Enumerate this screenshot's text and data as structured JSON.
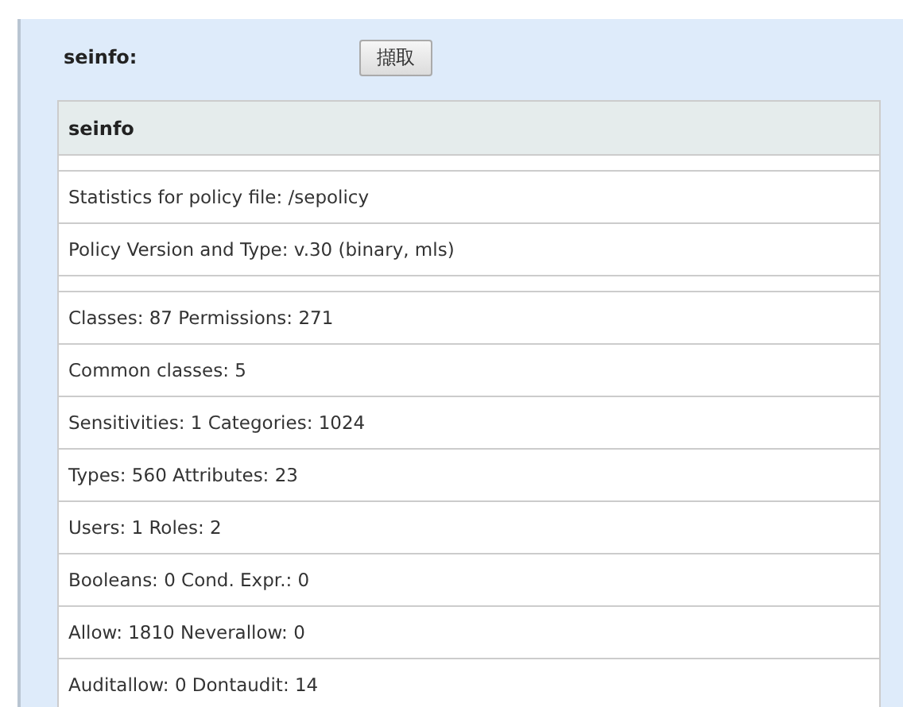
{
  "form": {
    "label": "seinfo:",
    "button": "擷取"
  },
  "table": {
    "header": "seinfo",
    "rows": [
      {
        "kind": "spacer"
      },
      {
        "kind": "text",
        "text": "Statistics for policy file: /sepolicy"
      },
      {
        "kind": "text",
        "text": "Policy Version and Type: v.30 (binary, mls)"
      },
      {
        "kind": "spacer"
      },
      {
        "kind": "text",
        "text": "Classes: 87 Permissions: 271"
      },
      {
        "kind": "text",
        "text": "Common classes: 5"
      },
      {
        "kind": "text",
        "text": "Sensitivities: 1 Categories: 1024"
      },
      {
        "kind": "text",
        "text": "Types: 560 Attributes: 23"
      },
      {
        "kind": "text",
        "text": "Users: 1 Roles: 2"
      },
      {
        "kind": "text",
        "text": "Booleans: 0 Cond. Expr.: 0"
      },
      {
        "kind": "text",
        "text": "Allow: 1810 Neverallow: 0"
      },
      {
        "kind": "text",
        "text": "Auditallow: 0 Dontaudit: 14"
      }
    ]
  }
}
